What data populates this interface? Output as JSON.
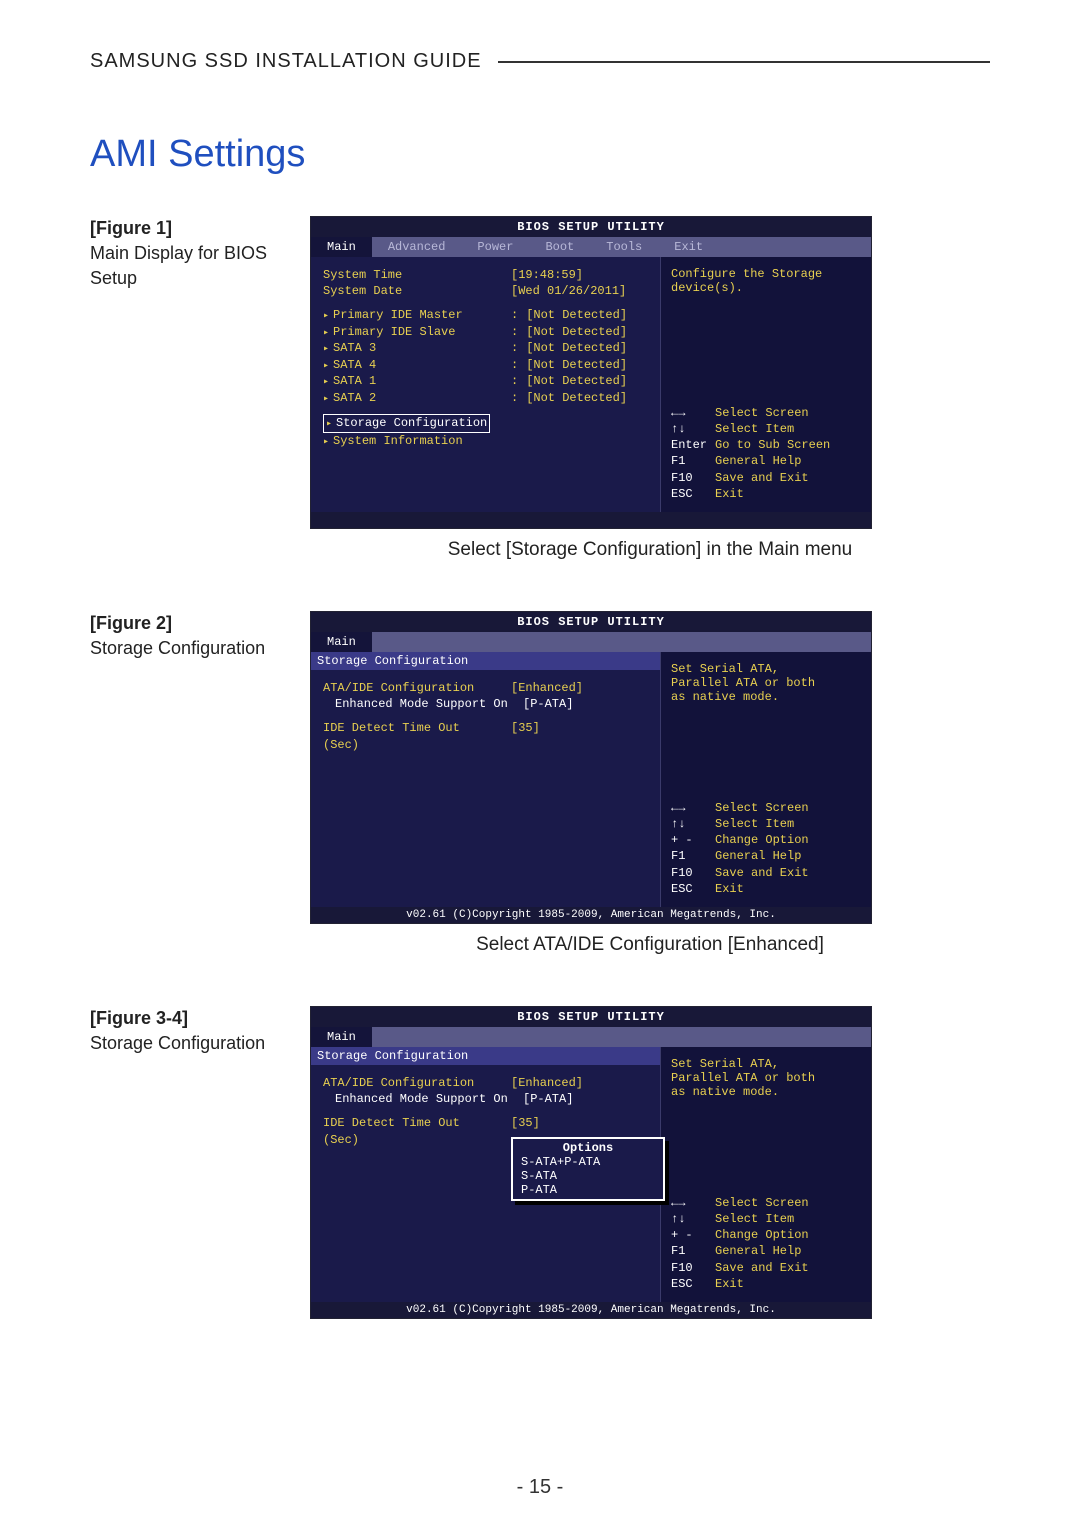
{
  "header": {
    "title": "SAMSUNG SSD INSTALLATION GUIDE"
  },
  "section_title": "AMI Settings",
  "page_number": "- 15 -",
  "figures": {
    "f1": {
      "label_bold": "[Figure 1]",
      "label_text": "Main Display for BIOS Setup",
      "caption": "Select [Storage Configuration] in the Main menu"
    },
    "f2": {
      "label_bold": "[Figure 2]",
      "label_text": "Storage Configuration",
      "caption": "Select ATA/IDE Configuration [Enhanced]"
    },
    "f3": {
      "label_bold": "[Figure 3-4]",
      "label_text": "Storage Configuration"
    }
  },
  "bios_common": {
    "title": "BIOS SETUP UTILITY",
    "footer": "v02.61 (C)Copyright 1985-2009, American Megatrends, Inc.",
    "tabs": {
      "main": "Main",
      "advanced": "Advanced",
      "power": "Power",
      "boot": "Boot",
      "tools": "Tools",
      "exit": "Exit"
    }
  },
  "bios1": {
    "help_top": "Configure the Storage device(s).",
    "rows": {
      "time_l": "System Time",
      "time_v": "[19:48:59]",
      "date_l": "System Date",
      "date_v": "[Wed 01/26/2011]",
      "pim_l": "Primary IDE Master",
      "pim_v": "[Not Detected]",
      "pis_l": "Primary IDE Slave",
      "pis_v": "[Not Detected]",
      "s3_l": "SATA 3",
      "s3_v": "[Not Detected]",
      "s4_l": "SATA 4",
      "s4_v": "[Not Detected]",
      "s1_l": "SATA 1",
      "s1_v": "[Not Detected]",
      "s2_l": "SATA 2",
      "s2_v": "[Not Detected]",
      "stor": "Storage Configuration",
      "sysinfo": "System Information"
    },
    "help": {
      "k1": "←→",
      "v1": "Select Screen",
      "k2": "↑↓",
      "v2": "Select Item",
      "k3": "Enter",
      "v3": "Go to Sub Screen",
      "k4": "F1",
      "v4": "General Help",
      "k5": "F10",
      "v5": "Save and Exit",
      "k6": "ESC",
      "v6": "Exit"
    }
  },
  "bios2": {
    "panel_title": "Storage Configuration",
    "help_top1": "Set Serial ATA,",
    "help_top2": "Parallel ATA or both",
    "help_top3": "as native mode.",
    "rows": {
      "ata_l": "ATA/IDE Configuration",
      "ata_v": "[Enhanced]",
      "enh_l": "Enhanced Mode Support On",
      "enh_v": "[P-ATA]",
      "ide_l": "IDE Detect Time Out (Sec)",
      "ide_v": "[35]"
    },
    "help": {
      "k1": "←→",
      "v1": "Select Screen",
      "k2": "↑↓",
      "v2": "Select Item",
      "k3": "+ -",
      "v3": "Change Option",
      "k4": "F1",
      "v4": "General Help",
      "k5": "F10",
      "v5": "Save and Exit",
      "k6": "ESC",
      "v6": "Exit"
    }
  },
  "bios3": {
    "options": {
      "title": "Options",
      "o1": "S-ATA+P-ATA",
      "o2": "S-ATA",
      "o3": "P-ATA"
    }
  }
}
